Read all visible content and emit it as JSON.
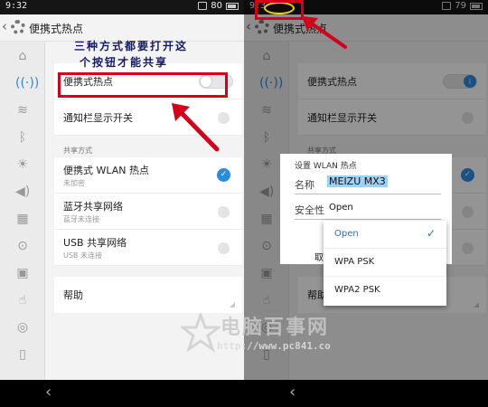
{
  "left": {
    "status": {
      "time": "9:32",
      "battery": "80"
    },
    "title": "便携式热点",
    "annotation_line1": "三种方式都要打开这",
    "annotation_line2": "个按钮才能共享",
    "rows": {
      "hotspot": "便携式热点",
      "notify": "通知栏显示开关",
      "section": "共享方式",
      "wlan": {
        "label": "便携式 WLAN 热点",
        "sub": "未加密"
      },
      "bt": {
        "label": "蓝牙共享网络",
        "sub": "蓝牙未连接"
      },
      "usb": {
        "label": "USB 共享网络",
        "sub": "USB 未连接"
      },
      "help": "帮助"
    }
  },
  "right": {
    "status": {
      "time": "9:3",
      "battery": "79"
    },
    "title": "便携式热点",
    "rows": {
      "hotspot": "便携式热点",
      "notify": "通知栏显示开关",
      "section": "共享方式",
      "help": "帮助"
    },
    "dialog": {
      "title": "设置 WLAN 热点",
      "name_label": "名称",
      "name_value": "MEIZU MX3",
      "security_label": "安全性",
      "security_value": "Open",
      "partial_button": "取"
    },
    "dropdown": {
      "items": [
        {
          "label": "Open",
          "selected": true
        },
        {
          "label": "WPA PSK",
          "selected": false
        },
        {
          "label": "WPA2 PSK",
          "selected": false
        }
      ]
    }
  },
  "watermark": {
    "text": "电脑百事网",
    "url": "http://www.pc841.co"
  },
  "colors": {
    "accent": "#2a8ce0",
    "annotation_red": "#d4001a",
    "highlight_yellow": "#f2d200"
  }
}
